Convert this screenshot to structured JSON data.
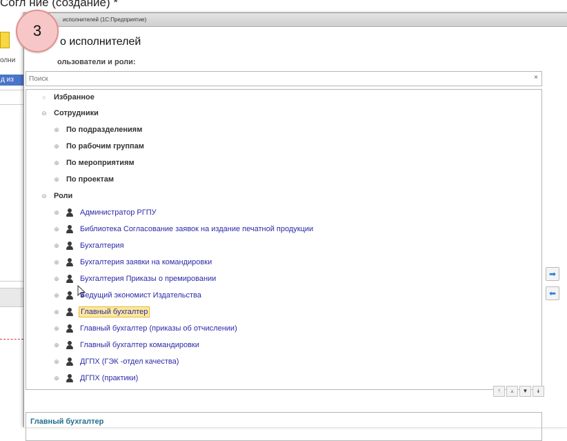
{
  "background_form": {
    "title": "Согл      ние (создание) *",
    "side_label": "олни",
    "side_tab": "д из"
  },
  "dialog": {
    "window_title": "исполнителей  (1С:Предприятие)",
    "title": "о исполнителей",
    "section_label": "ользователи и роли:",
    "search_placeholder": "Поиск",
    "search_clear": "×",
    "tree": {
      "groups": [
        {
          "label": "Избранное",
          "expander": "○"
        },
        {
          "label": "Сотрудники",
          "expander": "⊖"
        }
      ],
      "employee_subgroups": [
        {
          "label": "По подразделениям",
          "expander": "⊕"
        },
        {
          "label": "По рабочим группам",
          "expander": "⊕"
        },
        {
          "label": "По мероприятиям",
          "expander": "⊕"
        },
        {
          "label": "По проектам",
          "expander": "⊕"
        }
      ],
      "roles_group": {
        "label": "Роли",
        "expander": "⊖"
      },
      "roles": [
        {
          "label": "Администратор РГПУ",
          "selected": false
        },
        {
          "label": "Библиотека Согласование заявок на издание печатной продукции",
          "selected": false
        },
        {
          "label": "Бухгалтерия",
          "selected": false
        },
        {
          "label": "Бухгалтерия заявки на командировки",
          "selected": false
        },
        {
          "label": "Бухгалтерия Приказы о премировании",
          "selected": false
        },
        {
          "label": "Ведущий экономист Издательства",
          "selected": false
        },
        {
          "label": "Главный бухгалтер",
          "selected": true
        },
        {
          "label": "Главный бухгалтер (приказы об отчислении)",
          "selected": false
        },
        {
          "label": "Главный бухгалтер командировки",
          "selected": false
        },
        {
          "label": "ДГПХ (ГЭК -отдел качества)",
          "selected": false
        },
        {
          "label": "ДГПХ (практики)",
          "selected": false
        }
      ],
      "role_expander": "⊕"
    },
    "nav_buttons": {
      "first": "⯭",
      "up": "▲",
      "down": "▼",
      "last": "⯯"
    },
    "description": "Главный бухгалтер",
    "add_arrow": "➡",
    "remove_arrow": "⬅"
  },
  "step_badge": "3",
  "colors": {
    "selection_bg": "#fde99a",
    "role_link": "#2a2aa8",
    "description_text": "#1f6f8b",
    "badge": "#f6c7c6"
  }
}
